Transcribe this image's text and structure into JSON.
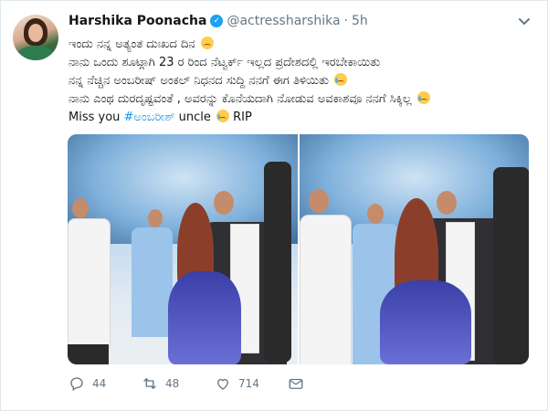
{
  "tweet": {
    "author_name": "Harshika Poonacha",
    "handle": "@actressharshika",
    "separator": "·",
    "time": "5h",
    "lines": [
      "ಇಂದು ನನ್ನ ಅತ್ಯಂತ ದುಃಖದ ದಿನ",
      "ನಾನು ಒಂದು ಶೂಟ್ಗಾಗಿ 23 ರ ರಿಂದ ನೆಟ್ವರ್ಕ್ ಇಲ್ಲದ ಪ್ರದೇಶದಲ್ಲಿ ಇರಬೇಕಾಯಿತು",
      "ನನ್ನ ನೆಚ್ಚಿನ ಅಂಬರೀಷ್ ಅಂಕಲ್ ನಿಧನದ ಸುದ್ದಿ ನನಗೆ ಈಗ ತಿಳಿಯಿತು",
      "ನಾನು ಎಂಥ ದುರದೃಷ್ಟವಂತೆ , ಅವರನ್ನು ಕೊನೆಯದಾಗಿ ನೋಡುವ ಅವಕಾಶವೂ ನನಗೆ ಸಿಕ್ಕಿಲ್ಲ"
    ],
    "last_line": {
      "prefix": "Miss you ",
      "hashtag": "#ಅಂಬರೀಶ್",
      "suffix_1": " uncle ",
      "suffix_2": " RIP"
    },
    "stats": {
      "replies": "44",
      "retweets": "48",
      "likes": "714"
    }
  },
  "icons": {
    "verified": "verified-badge-icon",
    "caret": "chevron-down-icon",
    "reply": "reply-icon",
    "retweet": "retweet-icon",
    "like": "heart-icon",
    "message": "envelope-icon"
  },
  "colors": {
    "accent": "#1da1f2",
    "hashtag": "#1b95e0",
    "muted": "#657786"
  }
}
